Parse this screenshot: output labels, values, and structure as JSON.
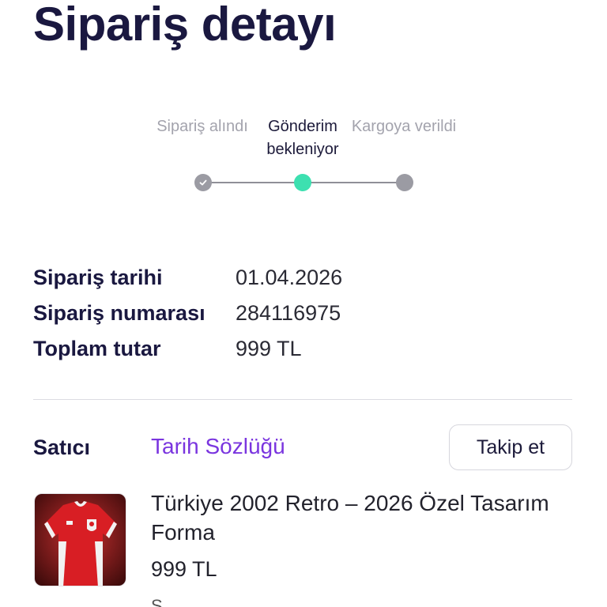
{
  "header": {
    "title": "Sipariş detayı"
  },
  "stepper": {
    "steps": [
      {
        "label": "Sipariş alındı",
        "state": "completed",
        "icon": "check-icon"
      },
      {
        "label": "Gönderim bekleniyor",
        "state": "active"
      },
      {
        "label": "Kargoya verildi",
        "state": "pending"
      }
    ],
    "colors": {
      "active": "#3de0b0",
      "inactive": "#9b9ba3"
    }
  },
  "order": {
    "date_label": "Sipariş tarihi",
    "date_value": "01.04.2026",
    "number_label": "Sipariş numarası",
    "number_value": "284116975",
    "total_label": "Toplam tutar",
    "total_value": "999 TL"
  },
  "seller": {
    "label": "Satıcı",
    "name": "Tarih Sözlüğü",
    "follow_label": "Takip et",
    "name_color": "#7a35df"
  },
  "product": {
    "name": "Türkiye 2002 Retro – 2026 Özel Tasarım Forma",
    "price": "999 TL",
    "image": "red-football-jersey-image",
    "next_line_partial": "S"
  }
}
